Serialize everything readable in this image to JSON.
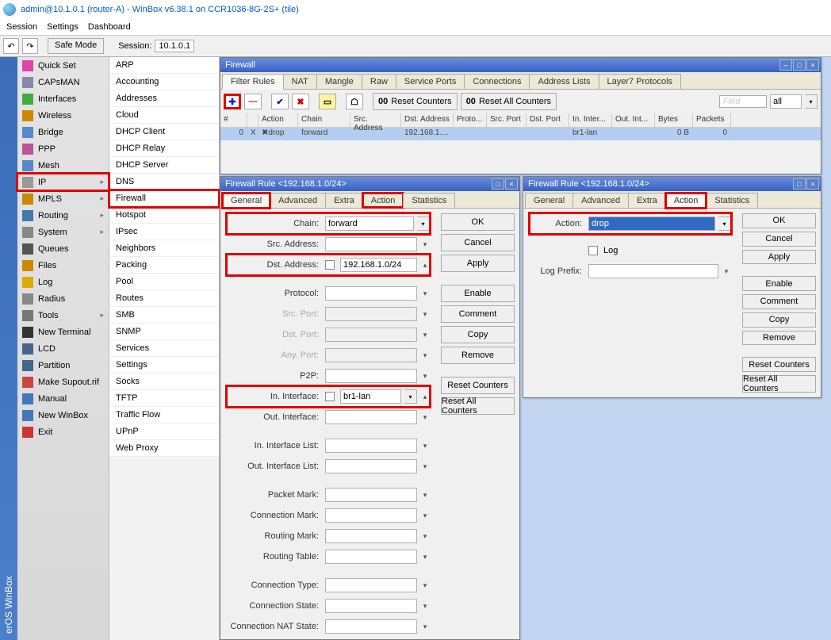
{
  "window": {
    "title": "admin@10.1.0.1 (router-A) - WinBox v6.38.1 on CCR1036-8G-2S+ (tile)"
  },
  "menubar": [
    "Session",
    "Settings",
    "Dashboard"
  ],
  "toolbar": {
    "safe_mode": "Safe Mode",
    "session_label": "Session:",
    "session_ip": "10.1.0.1"
  },
  "sidebar_text": "erOS WinBox",
  "menu1": [
    {
      "label": "Quick Set"
    },
    {
      "label": "CAPsMAN"
    },
    {
      "label": "Interfaces"
    },
    {
      "label": "Wireless"
    },
    {
      "label": "Bridge"
    },
    {
      "label": "PPP"
    },
    {
      "label": "Mesh"
    },
    {
      "label": "IP",
      "sub": true,
      "hl": true
    },
    {
      "label": "MPLS",
      "sub": true
    },
    {
      "label": "Routing",
      "sub": true
    },
    {
      "label": "System",
      "sub": true
    },
    {
      "label": "Queues"
    },
    {
      "label": "Files"
    },
    {
      "label": "Log"
    },
    {
      "label": "Radius"
    },
    {
      "label": "Tools",
      "sub": true
    },
    {
      "label": "New Terminal"
    },
    {
      "label": "LCD"
    },
    {
      "label": "Partition"
    },
    {
      "label": "Make Supout.rif"
    },
    {
      "label": "Manual"
    },
    {
      "label": "New WinBox"
    },
    {
      "label": "Exit"
    }
  ],
  "menu2": [
    "ARP",
    "Accounting",
    "Addresses",
    "Cloud",
    "DHCP Client",
    "DHCP Relay",
    "DHCP Server",
    "DNS",
    "Firewall",
    "Hotspot",
    "IPsec",
    "Neighbors",
    "Packing",
    "Pool",
    "Routes",
    "SMB",
    "SNMP",
    "Services",
    "Settings",
    "Socks",
    "TFTP",
    "Traffic Flow",
    "UPnP",
    "Web Proxy"
  ],
  "menu2_highlight": "Firewall",
  "firewall_window": {
    "title": "Firewall",
    "tabs": [
      "Filter Rules",
      "NAT",
      "Mangle",
      "Raw",
      "Service Ports",
      "Connections",
      "Address Lists",
      "Layer7 Protocols"
    ],
    "active_tab": "Filter Rules",
    "reset_counters": "Reset Counters",
    "reset_all": "Reset All Counters",
    "find": "Find",
    "all": "all",
    "cols": [
      "#",
      "",
      "Action",
      "Chain",
      "Src. Address",
      "Dst. Address",
      "Proto...",
      "Src. Port",
      "Dst. Port",
      "In. Inter...",
      "Out. Int...",
      "Bytes",
      "Packets"
    ],
    "row": {
      "num": "0",
      "x": "X",
      "action": "drop",
      "chain": "forward",
      "src": "",
      "dst": "192.168.1....",
      "proto": "",
      "sport": "",
      "dport": "",
      "inif": "br1-lan",
      "outif": "",
      "bytes": "0 B",
      "packets": "0"
    }
  },
  "rule_window": {
    "title": "Firewall Rule <192.168.1.0/24>",
    "tabs": [
      "General",
      "Advanced",
      "Extra",
      "Action",
      "Statistics"
    ],
    "buttons": [
      "OK",
      "Cancel",
      "Apply",
      "Enable",
      "Comment",
      "Copy",
      "Remove",
      "Reset Counters",
      "Reset All Counters"
    ],
    "fields": {
      "chain_label": "Chain:",
      "chain_val": "forward",
      "src_addr_label": "Src. Address:",
      "dst_addr_label": "Dst. Address:",
      "dst_addr_val": "192.168.1.0/24",
      "protocol_label": "Protocol:",
      "src_port_label": "Src. Port:",
      "dst_port_label": "Dst. Port:",
      "any_port_label": "Any. Port:",
      "p2p_label": "P2P:",
      "in_if_label": "In. Interface:",
      "in_if_val": "br1-lan",
      "out_if_label": "Out. Interface:",
      "in_if_list_label": "In. Interface List:",
      "out_if_list_label": "Out. Interface List:",
      "packet_mark_label": "Packet Mark:",
      "conn_mark_label": "Connection Mark:",
      "routing_mark_label": "Routing Mark:",
      "routing_table_label": "Routing Table:",
      "conn_type_label": "Connection Type:",
      "conn_state_label": "Connection State:",
      "conn_nat_label": "Connection NAT State:"
    }
  },
  "rule_window2": {
    "title": "Firewall Rule <192.168.1.0/24>",
    "action_label": "Action:",
    "action_val": "drop",
    "log_label": "Log",
    "log_prefix_label": "Log Prefix:"
  }
}
